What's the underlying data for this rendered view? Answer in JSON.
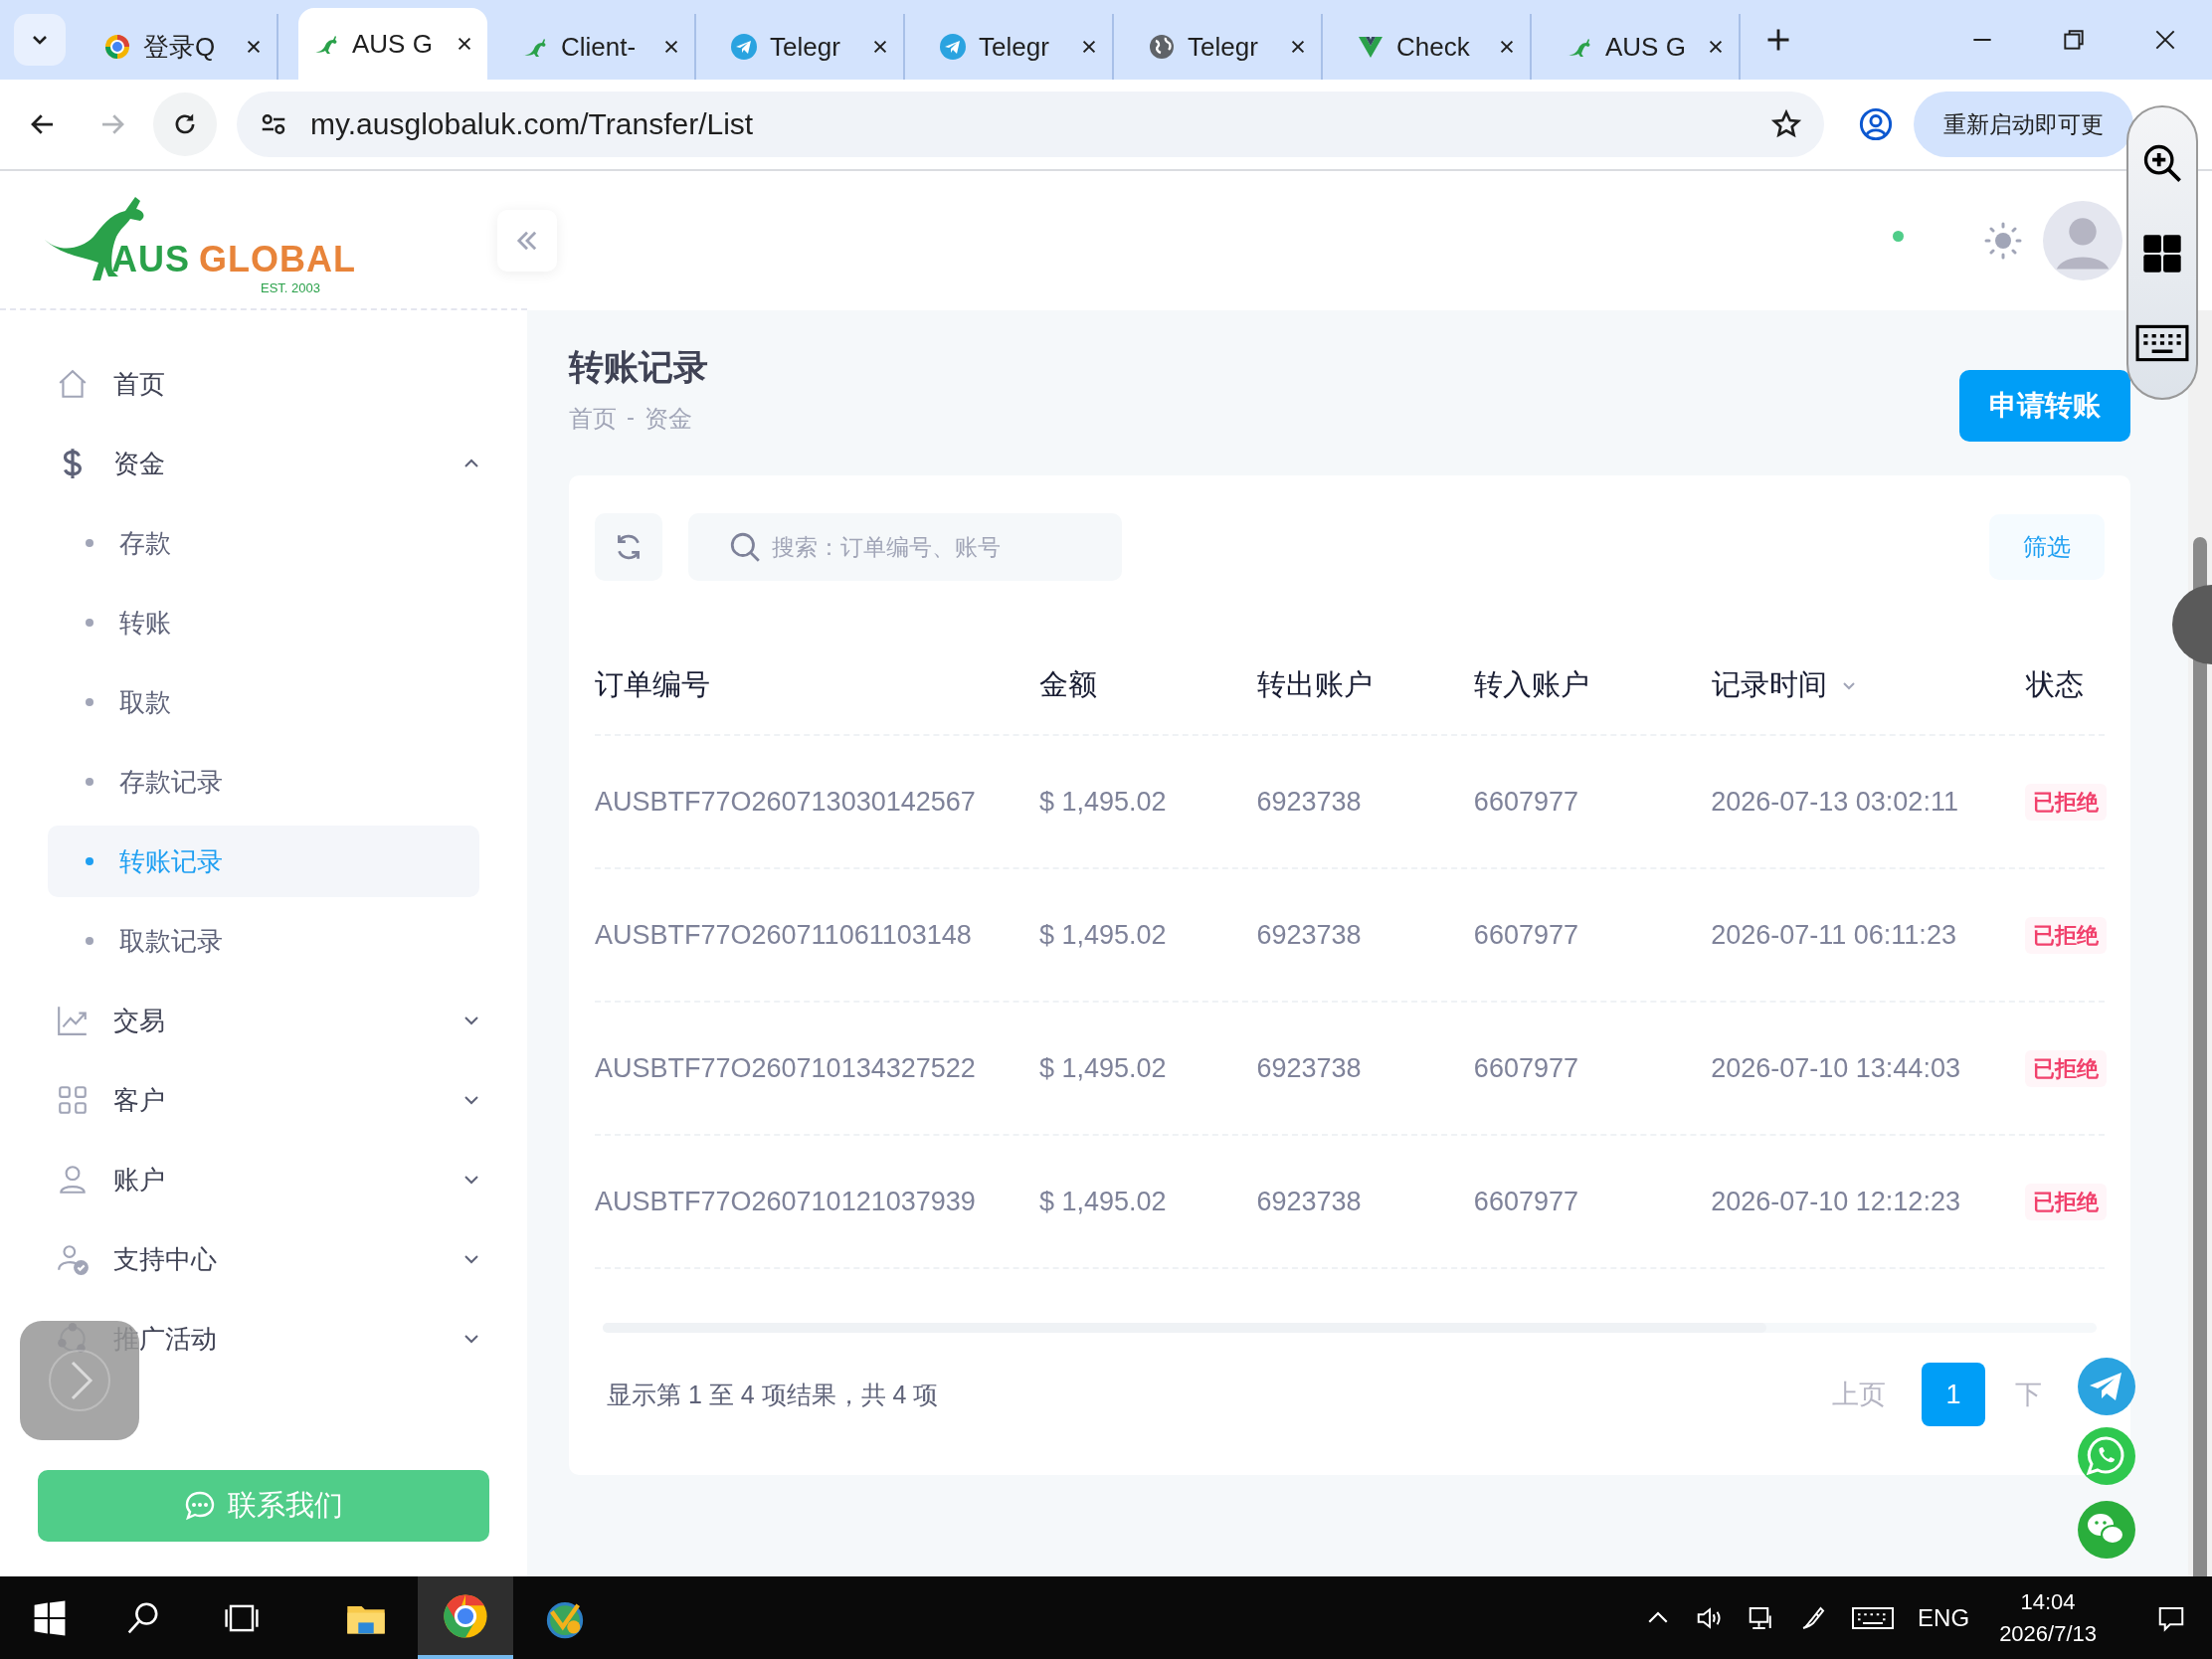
{
  "browser": {
    "tabs": [
      {
        "title": "登录Q",
        "kind": "browser",
        "selected": false
      },
      {
        "title": "AUS G",
        "kind": "kangaroo",
        "selected": true
      },
      {
        "title": "Client-",
        "kind": "kangaroo",
        "selected": false
      },
      {
        "title": "Telegr",
        "kind": "plane",
        "selected": false
      },
      {
        "title": "Telegr",
        "kind": "plane",
        "selected": false
      },
      {
        "title": "Telegr",
        "kind": "globe",
        "selected": false
      },
      {
        "title": "Check",
        "kind": "vee",
        "selected": false
      },
      {
        "title": "AUS G",
        "kind": "kangaroo",
        "selected": false
      }
    ],
    "address": "my.ausglobaluk.com/Transfer/List",
    "update_button": "重新启动即可更"
  },
  "logo": {
    "word_1": "AUS",
    "word_2": "GLOBAL",
    "tagline": "EST. 2003"
  },
  "sidebar": {
    "items": [
      {
        "label": "首页",
        "kind": "home"
      },
      {
        "label": "资金",
        "kind": "dollar",
        "expanded": true,
        "children": [
          {
            "label": "存款",
            "selected": false
          },
          {
            "label": "转账",
            "selected": false
          },
          {
            "label": "取款",
            "selected": false
          },
          {
            "label": "存款记录",
            "selected": false
          },
          {
            "label": "转账记录",
            "selected": true
          },
          {
            "label": "取款记录",
            "selected": false
          }
        ]
      },
      {
        "label": "交易",
        "kind": "chart",
        "expanded": false
      },
      {
        "label": "客户",
        "kind": "grid",
        "expanded": false
      },
      {
        "label": "账户",
        "kind": "user",
        "expanded": false
      },
      {
        "label": "支持中心",
        "kind": "support",
        "expanded": false
      },
      {
        "label": "推广活动",
        "kind": "promo",
        "expanded": false
      }
    ],
    "contact_button": "联系我们"
  },
  "page": {
    "title": "转账记录",
    "breadcrumb": [
      "首页",
      "资金"
    ],
    "separator": "-",
    "apply_button": "申请转账"
  },
  "toolbar": {
    "search_placeholder": "搜索：订单编号、账号",
    "filter_button": "筛选"
  },
  "table": {
    "columns": [
      {
        "label": "订单编号",
        "sortable": false
      },
      {
        "label": "金额",
        "sortable": false
      },
      {
        "label": "转出账户",
        "sortable": false
      },
      {
        "label": "转入账户",
        "sortable": false
      },
      {
        "label": "记录时间",
        "sortable": true
      },
      {
        "label": "状态",
        "sortable": false
      }
    ],
    "rows": [
      {
        "order": "AUSBTF77O260713030142567",
        "amount": "$ 1,495.02",
        "from": "6923738",
        "to": "6607977",
        "time": "2026-07-13 03:02:11",
        "status": "已拒绝"
      },
      {
        "order": "AUSBTF77O260711061103148",
        "amount": "$ 1,495.02",
        "from": "6923738",
        "to": "6607977",
        "time": "2026-07-11 06:11:23",
        "status": "已拒绝"
      },
      {
        "order": "AUSBTF77O260710134327522",
        "amount": "$ 1,495.02",
        "from": "6923738",
        "to": "6607977",
        "time": "2026-07-10 13:44:03",
        "status": "已拒绝"
      },
      {
        "order": "AUSBTF77O260710121037939",
        "amount": "$ 1,495.02",
        "from": "6923738",
        "to": "6607977",
        "time": "2026-07-10 12:12:23",
        "status": "已拒绝"
      }
    ]
  },
  "pagination": {
    "summary": "显示第 1 至 4 项结果，共 4 项",
    "prev": "上页",
    "pages": [
      {
        "label": "1",
        "selected": true
      }
    ],
    "next": "下"
  },
  "taskbar": {
    "apps": [
      {
        "kind": "folder",
        "active": false
      },
      {
        "kind": "chrome",
        "active": true
      },
      {
        "kind": "trader",
        "active": false
      }
    ],
    "language": "ENG",
    "time": "14:04",
    "date": "2026/7/13"
  }
}
